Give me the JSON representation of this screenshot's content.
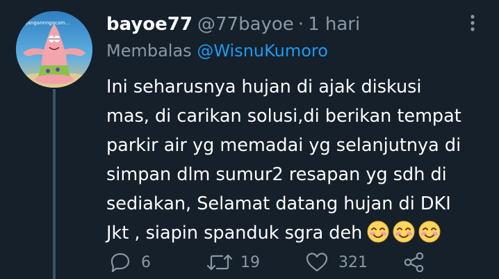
{
  "tweet": {
    "display_name": "bayoe77",
    "handle": "@77bayoe",
    "separator": "·",
    "time": "1 hari",
    "reply_prefix": "Membalas ",
    "reply_to": "@WisnuKumoro",
    "avatar_caption": "...jangannngacain...",
    "text": "Ini seharusnya hujan di ajak diskusi\nmas, di carikan solusi,di berikan tempat\nparkir air yg memadai yg selanjutnya di\nsimpan dlm sumur2 resapan yg sdh di\nsediakan, Selamat datang hujan di DKI\nJkt , siapin spanduk sgra deh",
    "emojis": [
      "smiling-face-with-smiling-eyes-icon",
      "smiling-face-with-smiling-eyes-icon",
      "smiling-face-with-smiling-eyes-icon"
    ]
  },
  "actions": {
    "reply_count": "6",
    "retweet_count": "19",
    "like_count": "321"
  },
  "colors": {
    "background": "#15202b",
    "text": "#ffffff",
    "muted": "#8b98a5",
    "accent": "#1d9bf0",
    "thread_line": "#3d5466"
  }
}
